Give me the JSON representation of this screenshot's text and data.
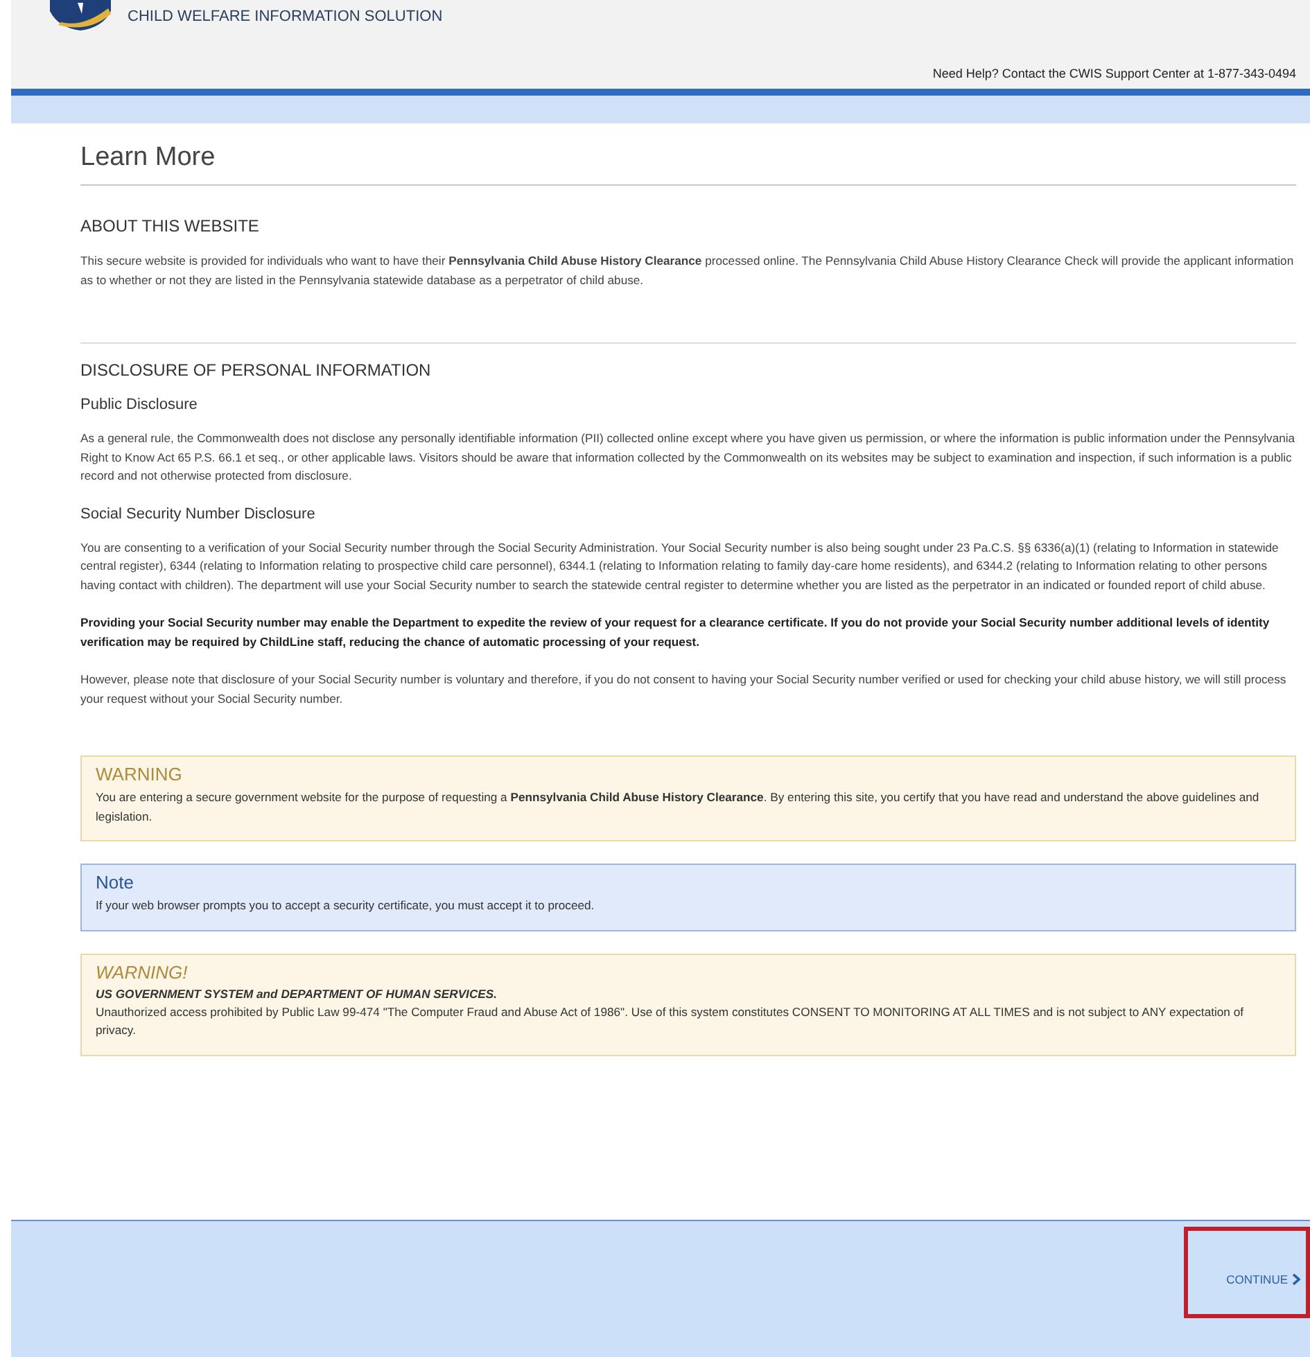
{
  "header": {
    "org_name": "CHILD WELFARE INFORMATION SOLUTION",
    "help_text": "Need Help? Contact the CWIS Support Center at 1-877-343-0494"
  },
  "page_title": "Learn More",
  "sections": [
    {
      "heading": "ABOUT THIS WEBSITE",
      "blocks": [
        {
          "kind": "paragraph",
          "text": "This secure website is provided for individuals who want to have their **Pennsylvania Child Abuse History Clearance** processed online. The Pennsylvania Child Abuse History Clearance Check will provide the applicant information as to whether or not they are listed in the Pennsylvania statewide database as a perpetrator of child abuse."
        }
      ]
    },
    {
      "heading": "DISCLOSURE OF PERSONAL INFORMATION",
      "blocks": [
        {
          "kind": "subheading",
          "text": "Public Disclosure"
        },
        {
          "kind": "paragraph",
          "text": "As a general rule, the Commonwealth does not disclose any personally identifiable information (PII) collected online except where you have given us permission, or where the information is public information under the Pennsylvania Right to Know Act 65 P.S. 66.1 et seq., or other applicable laws. Visitors should be aware that information collected by the Commonwealth on its websites may be subject to examination and inspection, if such information is a public record and not otherwise protected from disclosure."
        },
        {
          "kind": "subheading",
          "text": "Social Security Number Disclosure"
        },
        {
          "kind": "paragraph",
          "text": "You are consenting to a verification of your Social Security number through the Social Security Administration. Your Social Security number is also being sought under 23 Pa.C.S. §§ 6336(a)(1) (relating to Information in statewide central register), 6344 (relating to Information relating to prospective child care personnel), 6344.1 (relating to Information relating to family day-care home residents), and 6344.2 (relating to Information relating to other persons having contact with children). The department will use your Social Security number to search the statewide central register to determine whether you are listed as the perpetrator in an indicated or founded report of child abuse."
        },
        {
          "kind": "emphasis",
          "text": "Providing your Social Security number may enable the Department to expedite the review of your request for a clearance certificate.  If you do not provide your Social Security number additional levels of identity verification may be required by ChildLine staff, reducing the chance of automatic processing of your request."
        },
        {
          "kind": "paragraph",
          "text": "However, please note that disclosure of your Social Security number is voluntary and therefore, if you do not consent to having your Social Security number verified or used for checking your child abuse history, we will still process your request without your Social Security number."
        }
      ]
    }
  ],
  "alerts": [
    {
      "kind": "warning",
      "title": "WARNING",
      "lines": [
        "You are entering a secure government website for the purpose of requesting a **Pennsylvania Child Abuse History Clearance**. By entering this site, you certify that you have read and understand the above guidelines and legislation."
      ]
    },
    {
      "kind": "note",
      "title": "Note",
      "lines": [
        "If your web browser prompts you to accept a security certificate, you must accept it to proceed."
      ]
    },
    {
      "kind": "legal",
      "title": "WARNING!",
      "subtitle": "US GOVERNMENT SYSTEM and DEPARTMENT OF HUMAN SERVICES.",
      "lines": [
        "Unauthorized access prohibited by Public Law 99-474 \"The Computer Fraud and Abuse Act of 1986\". Use of this system constitutes CONSENT TO MONITORING AT ALL TIMES and is not subject to ANY expectation of privacy."
      ]
    }
  ],
  "footer": {
    "continue_label": "CONTINUE",
    "highlighted": true
  }
}
